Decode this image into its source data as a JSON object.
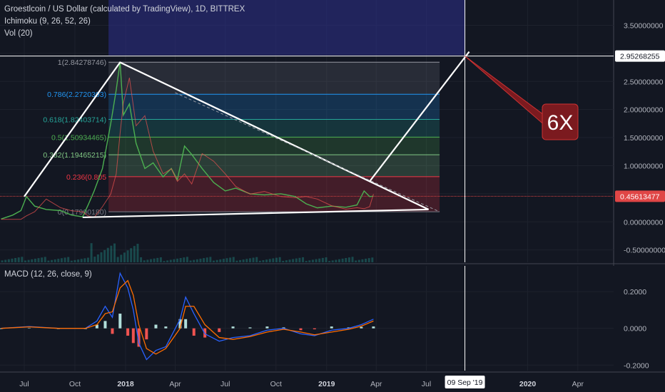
{
  "chart_data": [
    {
      "type": "line",
      "title": "Groestlcoin / US Dollar (calculated by TradingView), 1D, BITTREX",
      "indicators": [
        "Ichimoku (9, 26, 52, 26)",
        "Vol (20)"
      ],
      "y_ticks": [
        "3.50000000",
        "3.00000000",
        "2.50000000",
        "2.00000000",
        "1.50000000",
        "1.00000000",
        "0.50000000",
        "0.00000000",
        "-0.50000000"
      ],
      "y_tick_values": [
        3.5,
        3.0,
        2.5,
        2.0,
        1.5,
        1.0,
        0.5,
        0.0,
        -0.5
      ],
      "ylim": [
        -0.72,
        3.95
      ],
      "x_ticks": [
        "Jul",
        "Oct",
        "2018",
        "Apr",
        "Jul",
        "Oct",
        "2019",
        "Apr",
        "Jul",
        "2020",
        "Apr"
      ],
      "x_tick_dates": [
        "2017-07-01",
        "2017-10-01",
        "2018-01-01",
        "2018-04-01",
        "2018-07-01",
        "2018-10-01",
        "2019-01-01",
        "2019-04-01",
        "2019-07-01",
        "2020-01-01",
        "2020-04-01"
      ],
      "xlim": [
        "2017-05-18",
        "2020-06-05"
      ],
      "price_labels": [
        {
          "text": "2.95268255",
          "value": 2.95268255,
          "color": "#ffffff",
          "text_color": "#131722"
        },
        {
          "text": "0.45613477",
          "value": 0.45613477,
          "color": "#e04646",
          "text_color": "#ffffff"
        }
      ],
      "crosshair_date_label": "09 Sep '19",
      "crosshair_date": "2019-09-09",
      "crosshair_value": 2.95268255,
      "current_price_line": 0.45613477,
      "fib_levels": [
        {
          "ratio": 1,
          "price": 2.84278746,
          "label": "1(2.84278746)",
          "color": "#9598a1"
        },
        {
          "ratio": 0.786,
          "price": 2.2720393,
          "label": "0.786(2.2720393)",
          "color": "#2196f3"
        },
        {
          "ratio": 0.618,
          "price": 1.82403714,
          "label": "0.618(1.82403714)",
          "color": "#26a69a"
        },
        {
          "ratio": 0.5,
          "price": 1.50934465,
          "label": "0.5(1.50934465)",
          "color": "#4caf50"
        },
        {
          "ratio": 0.382,
          "price": 1.19465215,
          "label": "0.382(1.19465215)",
          "color": "#81c784"
        },
        {
          "ratio": 0.236,
          "price": 0.805,
          "label": "0.236(0.805",
          "color": "#f23645"
        },
        {
          "ratio": 0,
          "price": 0.1799018,
          "label": "0(0.17990180)",
          "color": "#787b86"
        }
      ],
      "price_path": [
        [
          "2017-05-20",
          0.05
        ],
        [
          "2017-06-10",
          0.12
        ],
        [
          "2017-06-25",
          0.2
        ],
        [
          "2017-07-05",
          0.45
        ],
        [
          "2017-07-20",
          0.28
        ],
        [
          "2017-08-10",
          0.22
        ],
        [
          "2017-09-05",
          0.2
        ],
        [
          "2017-09-25",
          0.12
        ],
        [
          "2017-10-15",
          0.09
        ],
        [
          "2017-10-25",
          0.3
        ],
        [
          "2017-11-05",
          0.55
        ],
        [
          "2017-11-20",
          0.95
        ],
        [
          "2017-12-05",
          1.75
        ],
        [
          "2017-12-15",
          2.35
        ],
        [
          "2017-12-22",
          2.85
        ],
        [
          "2017-12-28",
          1.9
        ],
        [
          "2018-01-08",
          2.1
        ],
        [
          "2018-01-20",
          1.4
        ],
        [
          "2018-02-05",
          0.95
        ],
        [
          "2018-02-20",
          1.05
        ],
        [
          "2018-03-10",
          0.8
        ],
        [
          "2018-03-25",
          0.95
        ],
        [
          "2018-04-05",
          0.75
        ],
        [
          "2018-04-18",
          1.35
        ],
        [
          "2018-05-01",
          1.2
        ],
        [
          "2018-05-20",
          0.95
        ],
        [
          "2018-06-10",
          0.7
        ],
        [
          "2018-07-01",
          0.55
        ],
        [
          "2018-07-20",
          0.6
        ],
        [
          "2018-08-15",
          0.5
        ],
        [
          "2018-09-10",
          0.48
        ],
        [
          "2018-10-10",
          0.5
        ],
        [
          "2018-11-05",
          0.45
        ],
        [
          "2018-11-25",
          0.32
        ],
        [
          "2018-12-15",
          0.25
        ],
        [
          "2019-01-10",
          0.28
        ],
        [
          "2019-02-05",
          0.26
        ],
        [
          "2019-02-25",
          0.3
        ],
        [
          "2019-03-10",
          0.55
        ],
        [
          "2019-03-20",
          0.45
        ],
        [
          "2019-03-27",
          0.456
        ]
      ],
      "triangle": {
        "apex_upper": [
          "2017-12-22",
          2.84
        ],
        "lower_left": [
          "2017-07-01",
          0.45
        ],
        "lower_base_left": [
          "2017-10-15",
          0.08
        ],
        "right_tip": [
          "2019-07-05",
          0.22
        ],
        "upper_end": [
          "2019-07-05",
          0.22
        ]
      },
      "projection": {
        "from": [
          "2019-03-20",
          0.72
        ],
        "to": [
          "2019-09-09",
          2.95268255
        ]
      },
      "annotation": {
        "text": "6X",
        "anchor": [
          "2019-09-09",
          2.9
        ]
      }
    },
    {
      "type": "line",
      "title": "MACD (12, 26, close, 9)",
      "y_ticks": [
        "0.2000",
        "0.0000",
        "-0.2000"
      ],
      "y_tick_values": [
        0.2,
        0.0,
        -0.2
      ],
      "ylim": [
        -0.23,
        0.34
      ],
      "macd_path": [
        [
          "2017-05-20",
          0.0
        ],
        [
          "2017-07-10",
          0.01
        ],
        [
          "2017-09-01",
          0.0
        ],
        [
          "2017-10-20",
          0.0
        ],
        [
          "2017-11-10",
          0.04
        ],
        [
          "2017-11-25",
          0.12
        ],
        [
          "2017-12-08",
          0.06
        ],
        [
          "2017-12-22",
          0.3
        ],
        [
          "2018-01-05",
          0.22
        ],
        [
          "2018-01-15",
          0.1
        ],
        [
          "2018-01-25",
          -0.08
        ],
        [
          "2018-02-08",
          -0.17
        ],
        [
          "2018-02-25",
          -0.12
        ],
        [
          "2018-03-15",
          -0.1
        ],
        [
          "2018-04-10",
          0.05
        ],
        [
          "2018-04-20",
          0.17
        ],
        [
          "2018-05-05",
          0.08
        ],
        [
          "2018-05-25",
          -0.03
        ],
        [
          "2018-06-20",
          -0.07
        ],
        [
          "2018-07-15",
          -0.05
        ],
        [
          "2018-08-15",
          -0.04
        ],
        [
          "2018-09-15",
          -0.01
        ],
        [
          "2018-10-15",
          0.0
        ],
        [
          "2018-11-15",
          -0.03
        ],
        [
          "2018-12-10",
          -0.04
        ],
        [
          "2019-01-10",
          -0.01
        ],
        [
          "2019-02-10",
          0.0
        ],
        [
          "2019-03-05",
          0.02
        ],
        [
          "2019-03-27",
          0.05
        ]
      ],
      "signal_path": [
        [
          "2017-05-20",
          0.0
        ],
        [
          "2017-07-10",
          0.008
        ],
        [
          "2017-09-01",
          0.0
        ],
        [
          "2017-10-20",
          0.0
        ],
        [
          "2017-11-10",
          0.02
        ],
        [
          "2017-11-25",
          0.08
        ],
        [
          "2017-12-08",
          0.09
        ],
        [
          "2017-12-22",
          0.22
        ],
        [
          "2018-01-05",
          0.26
        ],
        [
          "2018-01-15",
          0.18
        ],
        [
          "2018-01-25",
          0.02
        ],
        [
          "2018-02-08",
          -0.11
        ],
        [
          "2018-02-25",
          -0.14
        ],
        [
          "2018-03-15",
          -0.11
        ],
        [
          "2018-04-10",
          0.0
        ],
        [
          "2018-04-20",
          0.12
        ],
        [
          "2018-05-05",
          0.12
        ],
        [
          "2018-05-25",
          0.02
        ],
        [
          "2018-06-20",
          -0.05
        ],
        [
          "2018-07-15",
          -0.06
        ],
        [
          "2018-08-15",
          -0.045
        ],
        [
          "2018-09-15",
          -0.02
        ],
        [
          "2018-10-15",
          -0.005
        ],
        [
          "2018-11-15",
          -0.02
        ],
        [
          "2018-12-10",
          -0.035
        ],
        [
          "2019-01-10",
          -0.02
        ],
        [
          "2019-02-10",
          -0.005
        ],
        [
          "2019-03-05",
          0.012
        ],
        [
          "2019-03-27",
          0.04
        ]
      ],
      "hist_colors": {
        "pos": "#b2dfdb",
        "neg": "#ef5350"
      },
      "macd_color": "#2962ff",
      "signal_color": "#ff6d00"
    }
  ]
}
